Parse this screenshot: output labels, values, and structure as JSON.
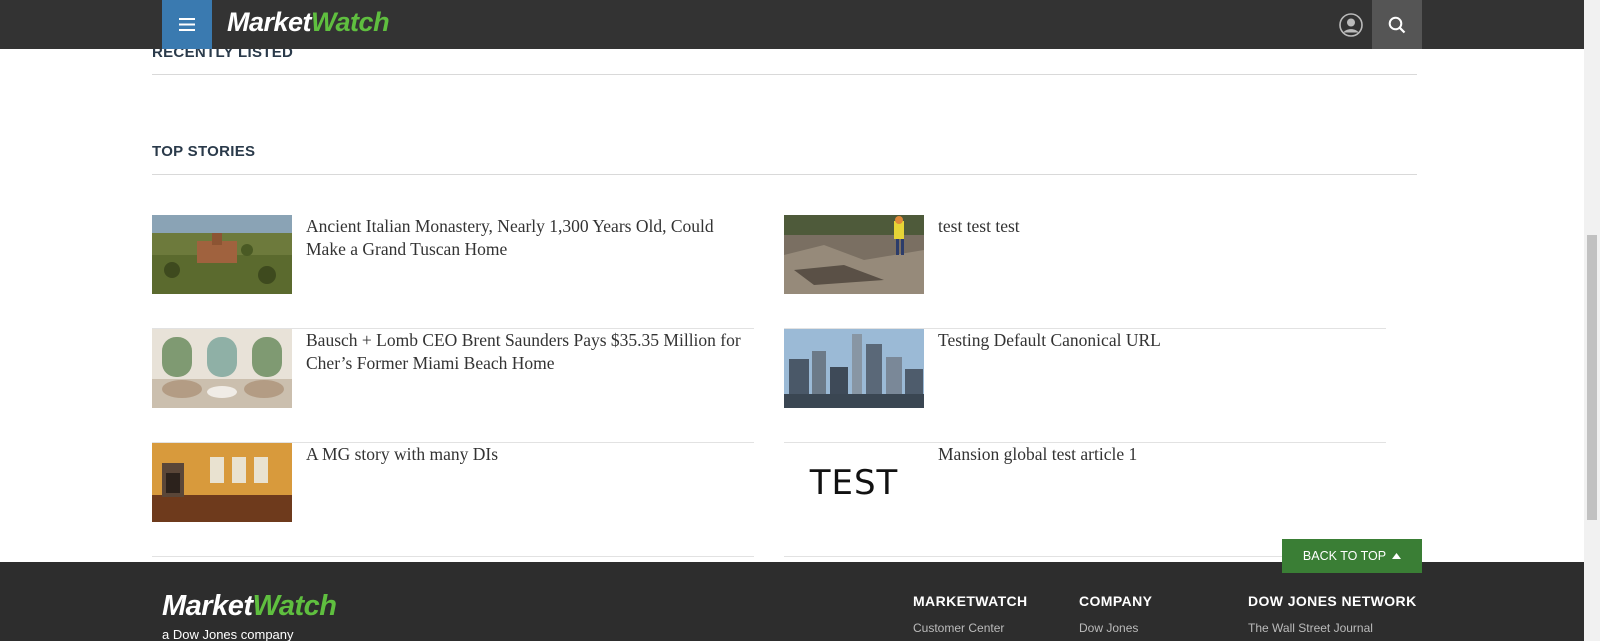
{
  "header": {
    "logo_prefix": "Market",
    "logo_suffix": "Watch"
  },
  "recently_listed": {
    "title": "RECENTLY LISTED"
  },
  "top_stories": {
    "title": "TOP STORIES",
    "left": [
      {
        "headline": "Ancient Italian Monastery, Nearly 1,300 Years Old, Could Make a Grand Tuscan Home"
      },
      {
        "headline": "Bausch + Lomb CEO Brent Saunders Pays $35.35 Million for Cher’s Former Miami Beach Home"
      },
      {
        "headline": "A MG story with many DIs"
      }
    ],
    "right": [
      {
        "headline": "test test test"
      },
      {
        "headline": "Testing Default Canonical URL"
      },
      {
        "headline": "Mansion global test article 1",
        "thumb_text": "TEST"
      }
    ]
  },
  "back_to_top": {
    "label": "BACK TO TOP"
  },
  "footer": {
    "logo_prefix": "Market",
    "logo_suffix": "Watch",
    "tagline": "a Dow Jones company",
    "columns": [
      {
        "title": "MARKETWATCH",
        "link": "Customer Center"
      },
      {
        "title": "COMPANY",
        "link": "Dow Jones"
      },
      {
        "title": "DOW JONES NETWORK",
        "link": "The Wall Street Journal"
      }
    ]
  },
  "colors": {
    "header_bg": "#333333",
    "menu_accent": "#3a7ab0",
    "brand_green": "#5fbf3f",
    "back_to_top_bg": "#3a7e35"
  }
}
